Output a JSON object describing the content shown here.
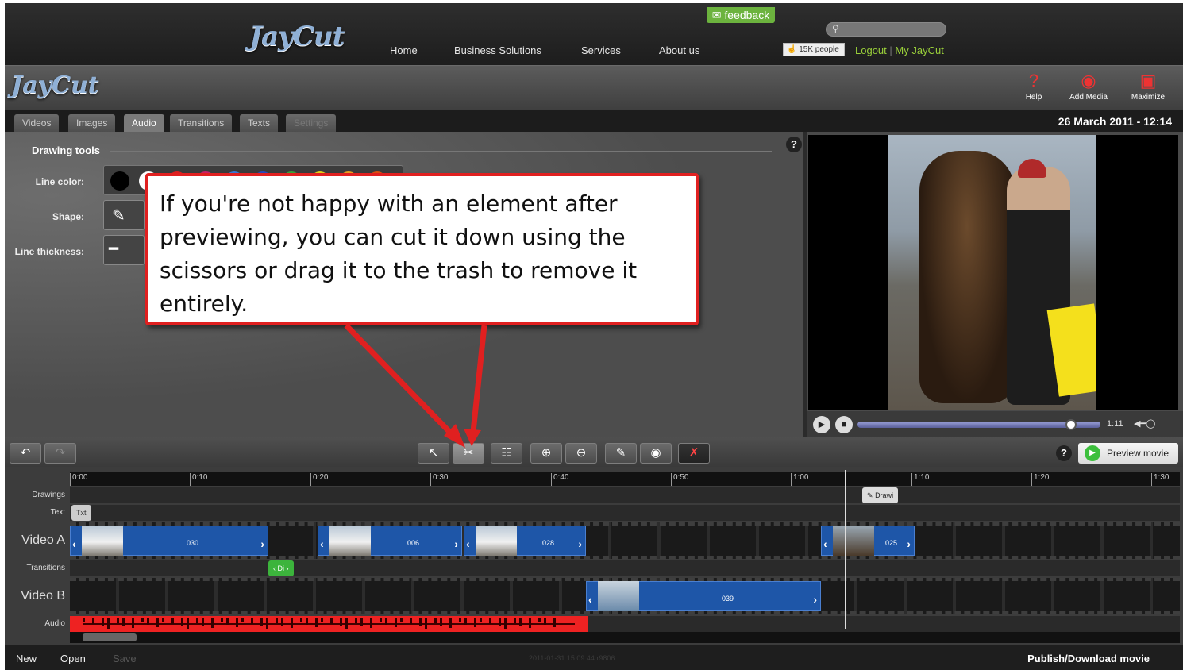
{
  "site": {
    "logo": "JayCut",
    "nav": [
      "Home",
      "Business Solutions",
      "Services",
      "About us"
    ],
    "feedback_label": "feedback",
    "like_label": "15K people",
    "logout_label": "Logout",
    "my_account_label": "My JayCut"
  },
  "app": {
    "logo": "JayCut",
    "toolbar": [
      {
        "label": "Help",
        "icon": "help-icon"
      },
      {
        "label": "Add Media",
        "icon": "camera-add-icon"
      },
      {
        "label": "Maximize",
        "icon": "maximize-icon"
      }
    ]
  },
  "tabs": [
    "Videos",
    "Images",
    "Audio",
    "Transitions",
    "Texts",
    "Settings"
  ],
  "active_tab": "Audio",
  "datetime": "26 March 2011 - 12:14",
  "drawing_tools": {
    "title": "Drawing tools",
    "line_color_label": "Line color:",
    "shape_label": "Shape:",
    "line_thickness_label": "Line thickness:",
    "colors": [
      "#000000",
      "#ffffff",
      "#e02020",
      "#d0206a",
      "#3a7ad8",
      "#2a4ac0",
      "#3aa53a",
      "#e6d21a",
      "#f0a020",
      "#e05010"
    ]
  },
  "callout": {
    "text": "If you're not happy with an element after previewing, you can cut it down using the scissors or drag it to the trash to remove it entirely."
  },
  "player": {
    "time": "1:11",
    "progress_fraction": 0.88
  },
  "edit_toolbar": {
    "preview_movie_label": "Preview movie",
    "tools": [
      "undo-icon",
      "redo-icon",
      "pointer-icon",
      "scissors-icon",
      "mixer-icon",
      "zoom-in-icon",
      "zoom-out-icon",
      "draw-icon",
      "webcam-icon",
      "trash-icon"
    ]
  },
  "timeline": {
    "ticks": [
      "0:00",
      "0:10",
      "0:20",
      "0:30",
      "0:40",
      "0:50",
      "1:00",
      "1:10",
      "1:20",
      "1:30"
    ],
    "tracks": {
      "drawings": "Drawings",
      "text": "Text",
      "video_a": "Video A",
      "transitions": "Transitions",
      "video_b": "Video B",
      "audio": "Audio"
    },
    "drawing_clip": "Drawi",
    "text_clip": "Txt",
    "transition_clip": "Di",
    "video_a_clips": [
      "030",
      "006",
      "028",
      "025"
    ],
    "video_b_clips": [
      "039"
    ]
  },
  "footer": {
    "new_label": "New",
    "open_label": "Open",
    "save_label": "Save",
    "build": "2011-01-31 15:09:44 r9806",
    "publish_label": "Publish/Download movie"
  }
}
